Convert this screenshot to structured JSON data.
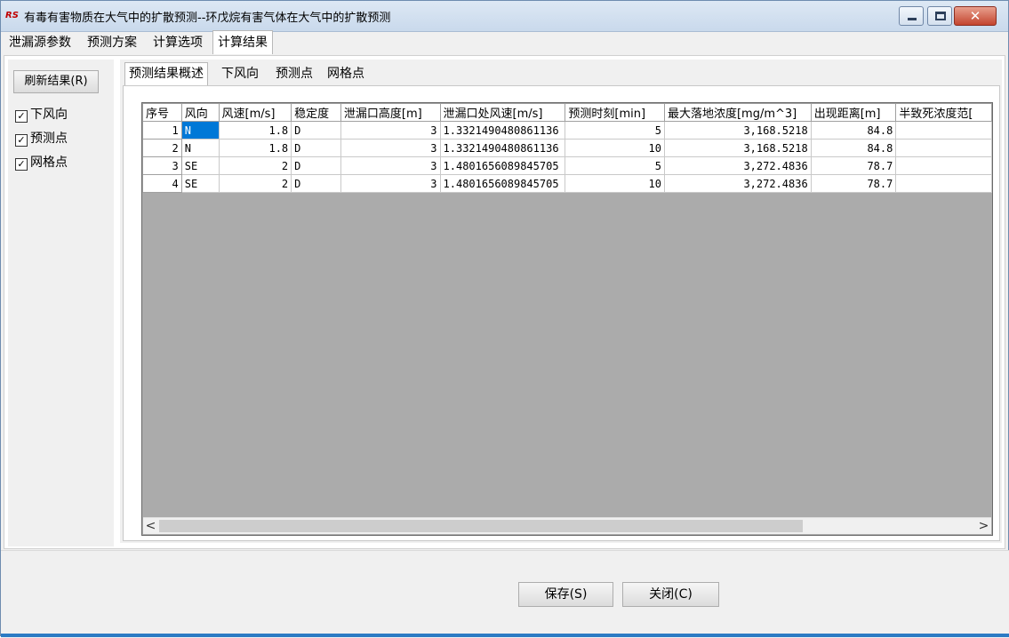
{
  "window": {
    "title": "有毒有害物质在大气中的扩散预测--环戊烷有害气体在大气中的扩散预测",
    "app_icon_text": "RS",
    "close_glyph": "✕"
  },
  "top_tabs": [
    "泄漏源参数",
    "预测方案",
    "计算选项",
    "计算结果"
  ],
  "left": {
    "refresh_label": "刷新结果(R)",
    "checks": [
      {
        "label": "下风向",
        "checked": true
      },
      {
        "label": "预测点",
        "checked": true
      },
      {
        "label": "网格点",
        "checked": true
      }
    ]
  },
  "inner_tabs": [
    "预测结果概述",
    "下风向",
    "预测点",
    "网格点"
  ],
  "grid": {
    "columns": [
      "序号",
      "风向",
      "风速[m/s]",
      "稳定度",
      "泄漏口高度[m]",
      "泄漏口处风速[m/s]",
      "预测时刻[min]",
      "最大落地浓度[mg/m^3]",
      "出现距离[m]",
      "半致死浓度范["
    ],
    "rows": [
      [
        "1",
        "N",
        "1.8",
        "D",
        "3",
        "1.3321490480861136",
        "5",
        "3,168.5218",
        "84.8",
        ""
      ],
      [
        "2",
        "N",
        "1.8",
        "D",
        "3",
        "1.3321490480861136",
        "10",
        "3,168.5218",
        "84.8",
        ""
      ],
      [
        "3",
        "SE",
        "2",
        "D",
        "3",
        "1.4801656089845705",
        "5",
        "3,272.4836",
        "78.7",
        ""
      ],
      [
        "4",
        "SE",
        "2",
        "D",
        "3",
        "1.4801656089845705",
        "10",
        "3,272.4836",
        "78.7",
        ""
      ]
    ],
    "scroll_left": "<",
    "scroll_right": ">"
  },
  "buttons": {
    "save": "保存(S)",
    "close": "关闭(C)"
  },
  "check_mark": "✓"
}
